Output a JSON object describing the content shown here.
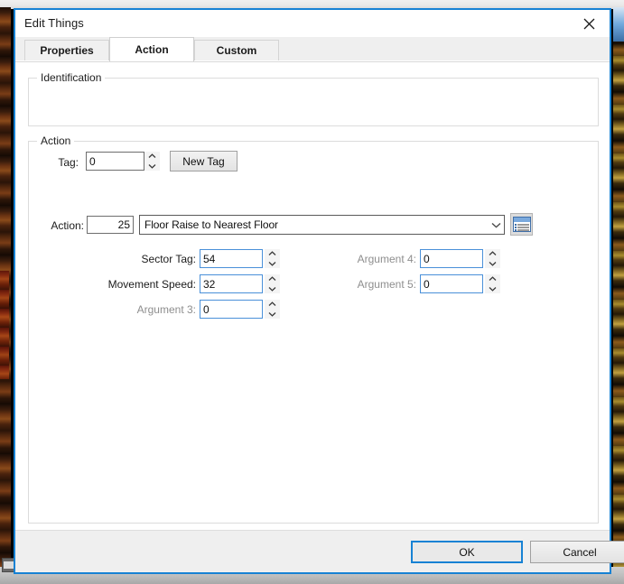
{
  "window": {
    "title": "Edit Things",
    "close_icon": "close-icon"
  },
  "tabs": [
    {
      "label": "Properties",
      "selected": false
    },
    {
      "label": "Action",
      "selected": true
    },
    {
      "label": "Custom",
      "selected": false
    }
  ],
  "identification": {
    "legend": "Identification",
    "tag_label": "Tag:",
    "tag_value": "0",
    "new_tag_label": "New Tag",
    "spinner_icon": "spinner-updown-icon"
  },
  "action": {
    "legend": "Action",
    "action_label": "Action:",
    "action_number": "25",
    "action_name": "Floor Raise to Nearest Floor",
    "dropdown_icon": "chevron-down-icon",
    "browse_icon": "action-browser-icon",
    "arguments_left": [
      {
        "label": "Sector Tag:",
        "value": "54",
        "dim": false
      },
      {
        "label": "Movement Speed:",
        "value": "32",
        "dim": false
      },
      {
        "label": "Argument 3:",
        "value": "0",
        "dim": true
      }
    ],
    "arguments_right": [
      {
        "label": "Argument 4:",
        "value": "0",
        "dim": true
      },
      {
        "label": "Argument 5:",
        "value": "0",
        "dim": true
      }
    ]
  },
  "footer": {
    "ok_label": "OK",
    "cancel_label": "Cancel"
  },
  "colors": {
    "window_border": "#1782d4",
    "focus_blue": "#1782d4",
    "input_blue_border": "#4a90d9",
    "dim_text": "#8e8e8e",
    "panel": "#efefef"
  }
}
